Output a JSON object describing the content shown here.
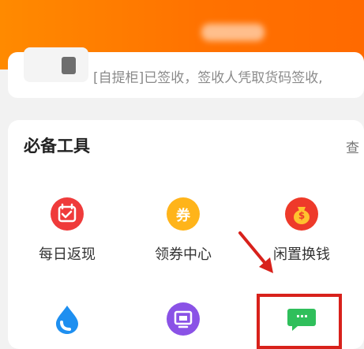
{
  "package_notice": {
    "text": "[自提柜]已签收，签收人凭取货码签收,"
  },
  "tools_section": {
    "title": "必备工具",
    "more_label": "查"
  },
  "tools": [
    {
      "label": "每日返现",
      "icon": "calendar-cashback-icon",
      "color": "#ef3b3b"
    },
    {
      "label": "领券中心",
      "icon": "coupon-icon",
      "color": "#ffb41a"
    },
    {
      "label": "闲置换钱",
      "icon": "money-bag-icon",
      "color": "#ee3a2a"
    },
    {
      "label": "",
      "icon": "water-drop-icon",
      "color": "#1e8ff0"
    },
    {
      "label": "",
      "icon": "screen-icon",
      "color": "#8a52e6"
    },
    {
      "label": "",
      "icon": "message-bubble-icon",
      "color": "#2fbf5b"
    }
  ],
  "glyphs": {
    "coupon": "券",
    "money": "$",
    "dots": "···"
  },
  "colors": {
    "header": "#ff7a00",
    "highlight_box": "#d8211b"
  }
}
